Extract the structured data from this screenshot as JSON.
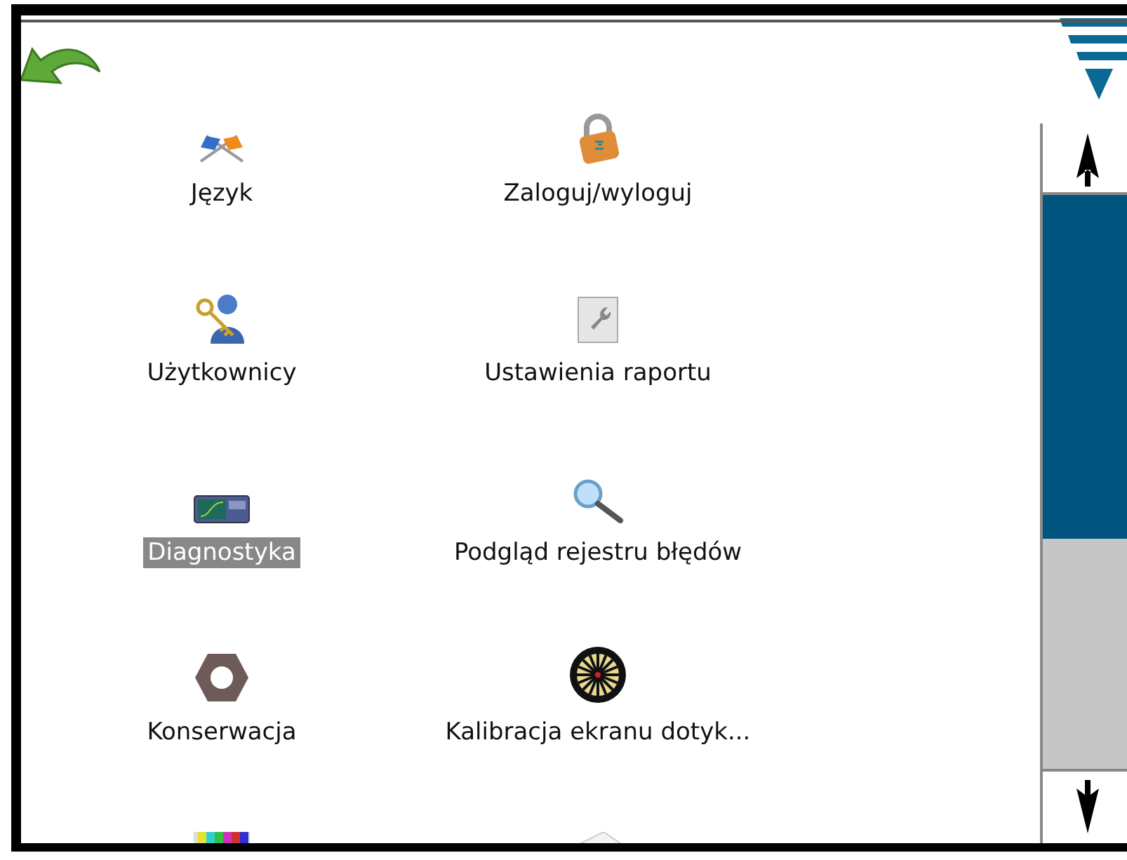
{
  "items": [
    {
      "label": "Język",
      "selected": false
    },
    {
      "label": "Zaloguj/wyloguj",
      "selected": false
    },
    {
      "label": "Użytkownicy",
      "selected": false
    },
    {
      "label": "Ustawienia raportu",
      "selected": false
    },
    {
      "label": "Diagnostyka",
      "selected": true
    },
    {
      "label": "Podgląd rejestru błędów",
      "selected": false
    },
    {
      "label": "Konserwacja",
      "selected": false
    },
    {
      "label": "Kalibracja ekranu dotyk...",
      "selected": false
    }
  ]
}
